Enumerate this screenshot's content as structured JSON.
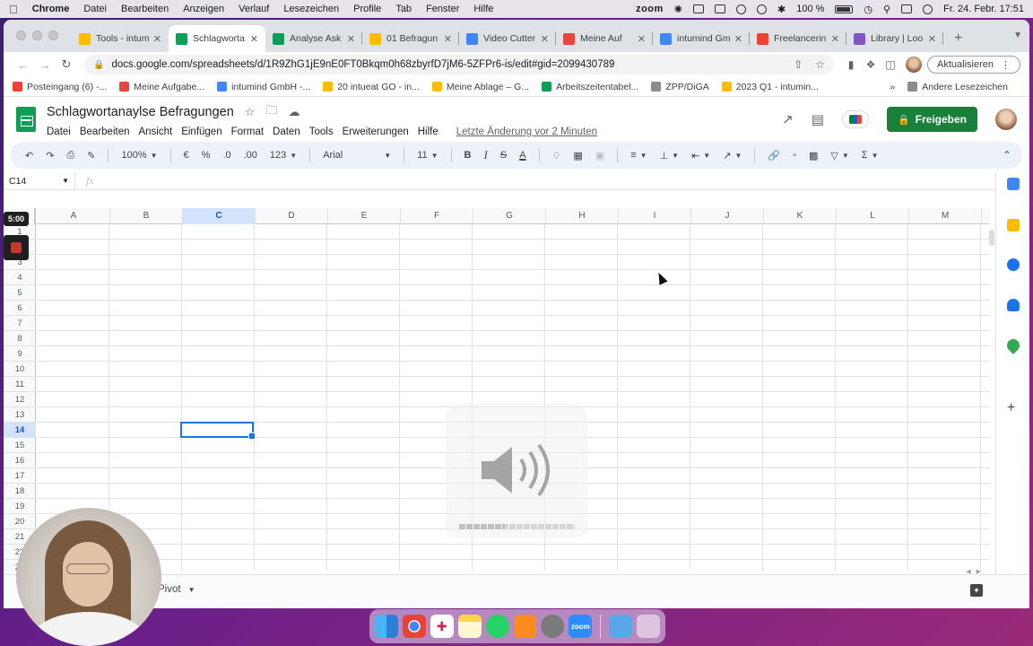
{
  "menubar": {
    "app": "Chrome",
    "items": [
      "Datei",
      "Bearbeiten",
      "Anzeigen",
      "Verlauf",
      "Lesezeichen",
      "Profile",
      "Tab",
      "Fenster",
      "Hilfe"
    ],
    "zoom": "zoom",
    "battery": "100 %",
    "datetime": "Fr. 24. Febr. 17:51"
  },
  "tabs": [
    {
      "label": "Tools - intum",
      "color": "#fbbc04"
    },
    {
      "label": "Schlagworta",
      "color": "#0f9d58",
      "active": true
    },
    {
      "label": "Analyse Ask",
      "color": "#0f9d58"
    },
    {
      "label": "01 Befragun",
      "color": "#fbbc04"
    },
    {
      "label": "Video Cutter",
      "color": "#4285f4"
    },
    {
      "label": "Meine Auf",
      "color": "#e8453c"
    },
    {
      "label": "intumind Gm",
      "color": "#4285f4"
    },
    {
      "label": "Freelancerin",
      "color": "#ea4335"
    },
    {
      "label": "Library | Loo",
      "color": "#7e57c2"
    }
  ],
  "address": {
    "url": "docs.google.com/spreadsheets/d/1R9ZhG1jE9nE0FT0Bkqm0h68zbyrfD7jM6-5ZFPr6-is/edit#gid=2099430789",
    "update_label": "Aktualisieren"
  },
  "bookmarks": [
    {
      "label": "Posteingang (6) -...",
      "color": "#ea4335"
    },
    {
      "label": "Meine Aufgabe...",
      "color": "#e8453c"
    },
    {
      "label": "intumind GmbH -...",
      "color": "#4285f4"
    },
    {
      "label": "20 intueat GO - in...",
      "color": "#fbbc04"
    },
    {
      "label": "Meine Ablage – G...",
      "color": "#fbbc04"
    },
    {
      "label": "Arbeitszeitentabel...",
      "color": "#0f9d58"
    },
    {
      "label": "ZPP/DiGA",
      "color": "#8c8c8c"
    },
    {
      "label": "2023 Q1 - intumin...",
      "color": "#fbbc04"
    }
  ],
  "bookmarks_other": "Andere Lesezeichen",
  "doc": {
    "title": "Schlagwortanaylse Befragungen",
    "menu": [
      "Datei",
      "Bearbeiten",
      "Ansicht",
      "Einfügen",
      "Format",
      "Daten",
      "Tools",
      "Erweiterungen",
      "Hilfe"
    ],
    "last_edit": "Letzte Änderung vor 2 Minuten",
    "share_label": "Freigeben"
  },
  "toolbar": {
    "zoom": "100%",
    "currency": "€",
    "percent": "%",
    "dec_less": ".0",
    "dec_more": ".00",
    "format_num": "123",
    "font": "Arial",
    "font_size": "11"
  },
  "namebox": "C14",
  "columns": [
    "A",
    "B",
    "C",
    "D",
    "E",
    "F",
    "G",
    "H",
    "I",
    "J",
    "K",
    "L",
    "M"
  ],
  "selected_column": "C",
  "rows": [
    "1",
    "2",
    "3",
    "4",
    "5",
    "6",
    "7",
    "8",
    "9",
    "10",
    "11",
    "12",
    "13",
    "14",
    "15",
    "16",
    "17",
    "18",
    "19",
    "20",
    "21",
    "22",
    "23"
  ],
  "selected_row": "14",
  "sheet_tab": "Pivot",
  "overlay": {
    "timer": "5:00",
    "volume_level": 0.4
  }
}
